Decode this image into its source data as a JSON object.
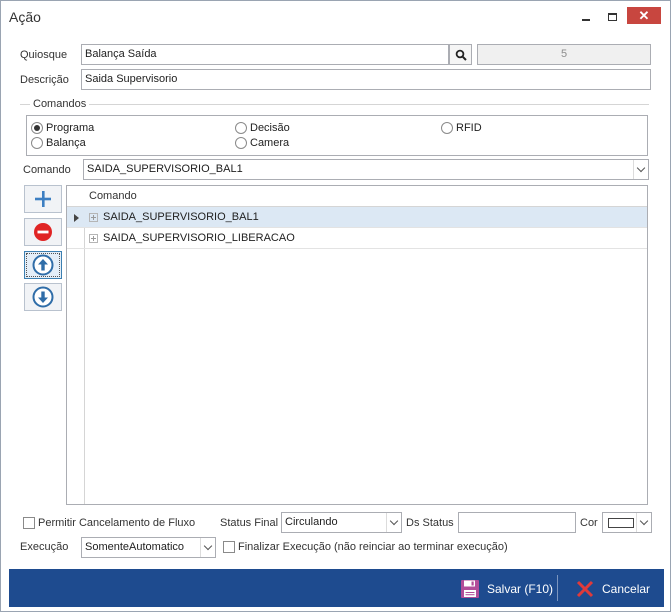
{
  "window": {
    "title": "Ação"
  },
  "form": {
    "quiosque_label": "Quiosque",
    "quiosque_value": "Balança Saída",
    "quiosque_code": "5",
    "descricao_label": "Descrição",
    "descricao_value": "Saida Supervisorio",
    "comandos_group": "Comandos",
    "radios": [
      {
        "label": "Programa",
        "checked": true
      },
      {
        "label": "Decisão",
        "checked": false
      },
      {
        "label": "RFID",
        "checked": false
      },
      {
        "label": "Balança",
        "checked": false
      },
      {
        "label": "Camera",
        "checked": false
      }
    ],
    "comando_label": "Comando",
    "comando_value": "SAIDA_SUPERVISORIO_BAL1"
  },
  "grid": {
    "column": "Comando",
    "rows": [
      {
        "value": "SAIDA_SUPERVISORIO_BAL1",
        "selected": true
      },
      {
        "value": "SAIDA_SUPERVISORIO_LIBERACAO",
        "selected": false
      }
    ]
  },
  "options": {
    "permitir_cancelamento": "Permitir Cancelamento de Fluxo",
    "status_final_label": "Status Final",
    "status_final_value": "Circulando",
    "ds_status_label": "Ds Status",
    "ds_status_value": "",
    "cor_label": "Cor",
    "execucao_label": "Execução",
    "execucao_value": "SomenteAutomatico",
    "finalizar_execucao": "Finalizar Execução (não reinciar ao terminar execução)"
  },
  "footer": {
    "save_label": "Salvar (F10)",
    "cancel_label": "Cancelar",
    "bar_color": "#1e4b8f"
  },
  "icons": [
    "search-icon",
    "add-icon",
    "remove-icon",
    "move-up-icon",
    "move-down-icon",
    "save-icon",
    "cancel-icon"
  ]
}
